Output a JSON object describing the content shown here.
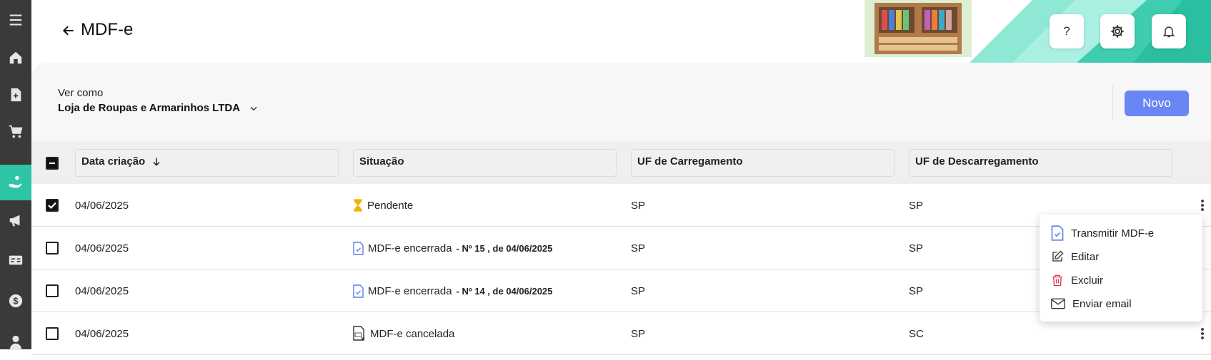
{
  "sidebar": {
    "items": [
      {
        "icon": "menu-icon"
      },
      {
        "icon": "home-icon"
      },
      {
        "icon": "document-plus-icon"
      },
      {
        "icon": "cart-icon"
      },
      {
        "icon": "hand-coins-icon",
        "active": true
      },
      {
        "icon": "megaphone-icon"
      },
      {
        "icon": "id-card-icon"
      },
      {
        "icon": "dollar-icon"
      },
      {
        "icon": "user-icon"
      }
    ]
  },
  "header": {
    "title": "MDF-e",
    "help_label": "?"
  },
  "filter": {
    "label": "Ver como",
    "value": "Loja de Roupas e Armarinhos LTDA"
  },
  "actions": {
    "new_label": "Novo"
  },
  "table": {
    "headers": {
      "date": "Data criação",
      "status": "Situação",
      "uf_load": "UF de Carregamento",
      "uf_unload": "UF de Descarregamento"
    },
    "rows": [
      {
        "checked": true,
        "date": "04/06/2025",
        "status": "Pendente",
        "status_detail": "",
        "uf_load": "SP",
        "uf_unload": "SP",
        "icon": "hourglass-icon"
      },
      {
        "checked": false,
        "date": "04/06/2025",
        "status": "MDF-e encerrada",
        "status_detail": "- Nº 15 , de 04/06/2025",
        "uf_load": "SP",
        "uf_unload": "SP",
        "icon": "document-check-icon"
      },
      {
        "checked": false,
        "date": "04/06/2025",
        "status": "MDF-e encerrada",
        "status_detail": "- Nº 14 , de 04/06/2025",
        "uf_load": "SP",
        "uf_unload": "SP",
        "icon": "document-check-icon"
      },
      {
        "checked": false,
        "date": "04/06/2025",
        "status": "MDF-e cancelada",
        "status_detail": "",
        "uf_load": "SP",
        "uf_unload": "SC",
        "icon": "nfe-cancel-icon"
      }
    ]
  },
  "context_menu": {
    "items": [
      {
        "label": "Transmitir MDF-e",
        "icon": "document-check-icon"
      },
      {
        "label": "Editar",
        "icon": "edit-icon"
      },
      {
        "label": "Excluir",
        "icon": "trash-icon"
      },
      {
        "label": "Enviar email",
        "icon": "mail-icon"
      }
    ]
  },
  "colors": {
    "accent": "#2ec4a6",
    "primary_button": "#6a86f5",
    "danger": "#e0334f",
    "pending": "#f0b400",
    "sidebar": "#3a3a3a"
  }
}
